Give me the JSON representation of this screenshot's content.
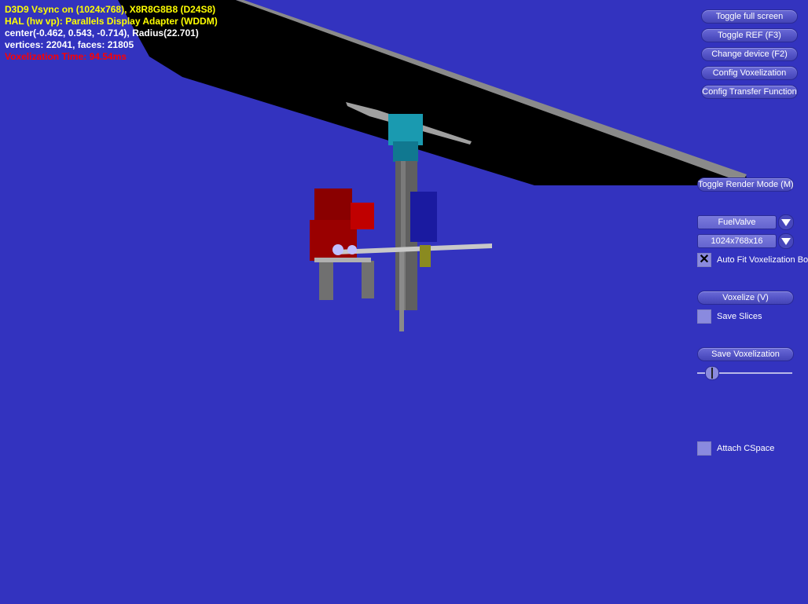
{
  "stats": {
    "line1": "D3D9 Vsync on (1024x768), X8R8G8B8 (D24S8)",
    "line2": "HAL (hw vp): Parallels Display Adapter (WDDM)",
    "line3": "center(-0.462, 0.543, -0.714), Radius(22.701)",
    "line4": "vertices: 22041, faces: 21805",
    "line5": "Voxelization Time: 94.54ms"
  },
  "buttons": {
    "toggle_full_screen": "Toggle full screen",
    "toggle_ref": "Toggle REF (F3)",
    "change_device": "Change device (F2)",
    "config_voxelization": "Config Voxelization",
    "config_transfer_function": "Config Transfer Function",
    "toggle_render_mode": "Toggle Render Mode (M)",
    "voxelize": "Voxelize (V)",
    "save_voxelization": "Save Voxelization"
  },
  "combos": {
    "model": "FuelValve",
    "resolution": "1024x768x16"
  },
  "checkboxes": {
    "auto_fit_label": "Auto Fit Voxelization Bo",
    "auto_fit_checked": true,
    "save_slices_label": "Save Slices",
    "save_slices_checked": false,
    "attach_cspace_label": "Attach CSpace",
    "attach_cspace_checked": false
  },
  "slider": {
    "value_fraction": 0.1
  },
  "colors": {
    "background": "#3333bf",
    "stats_text": "#ffff00",
    "info_text": "#ffffff",
    "warning_text": "#ff0000"
  }
}
